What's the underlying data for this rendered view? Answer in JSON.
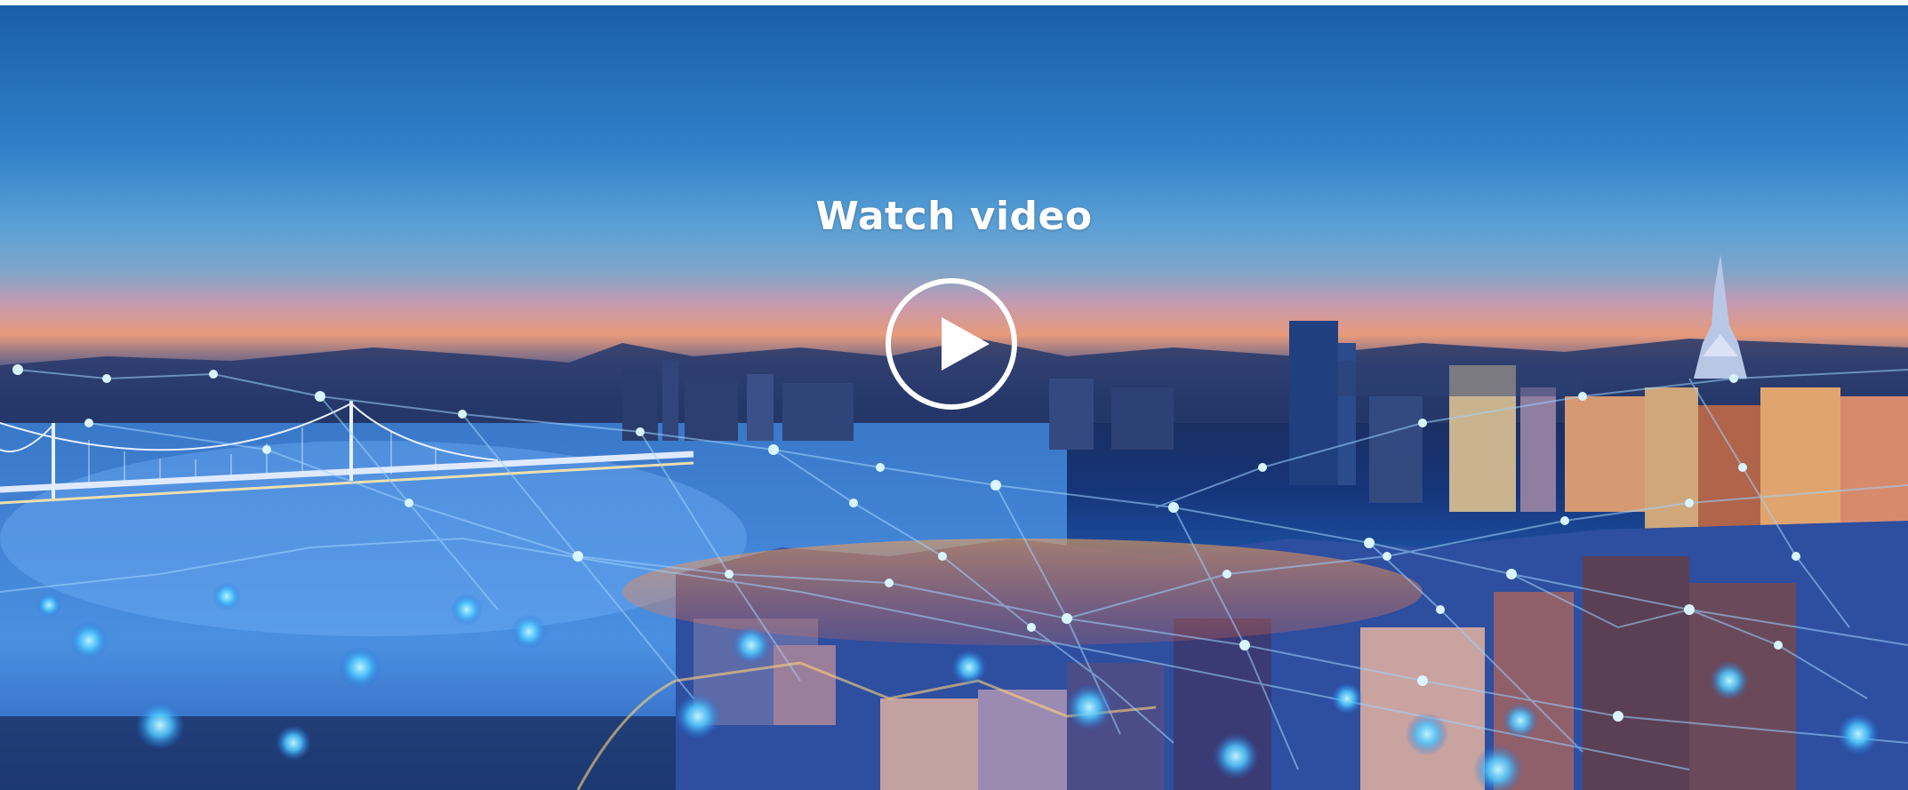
{
  "hero": {
    "title": "Watch video"
  },
  "icons": {
    "play": "play-icon"
  }
}
